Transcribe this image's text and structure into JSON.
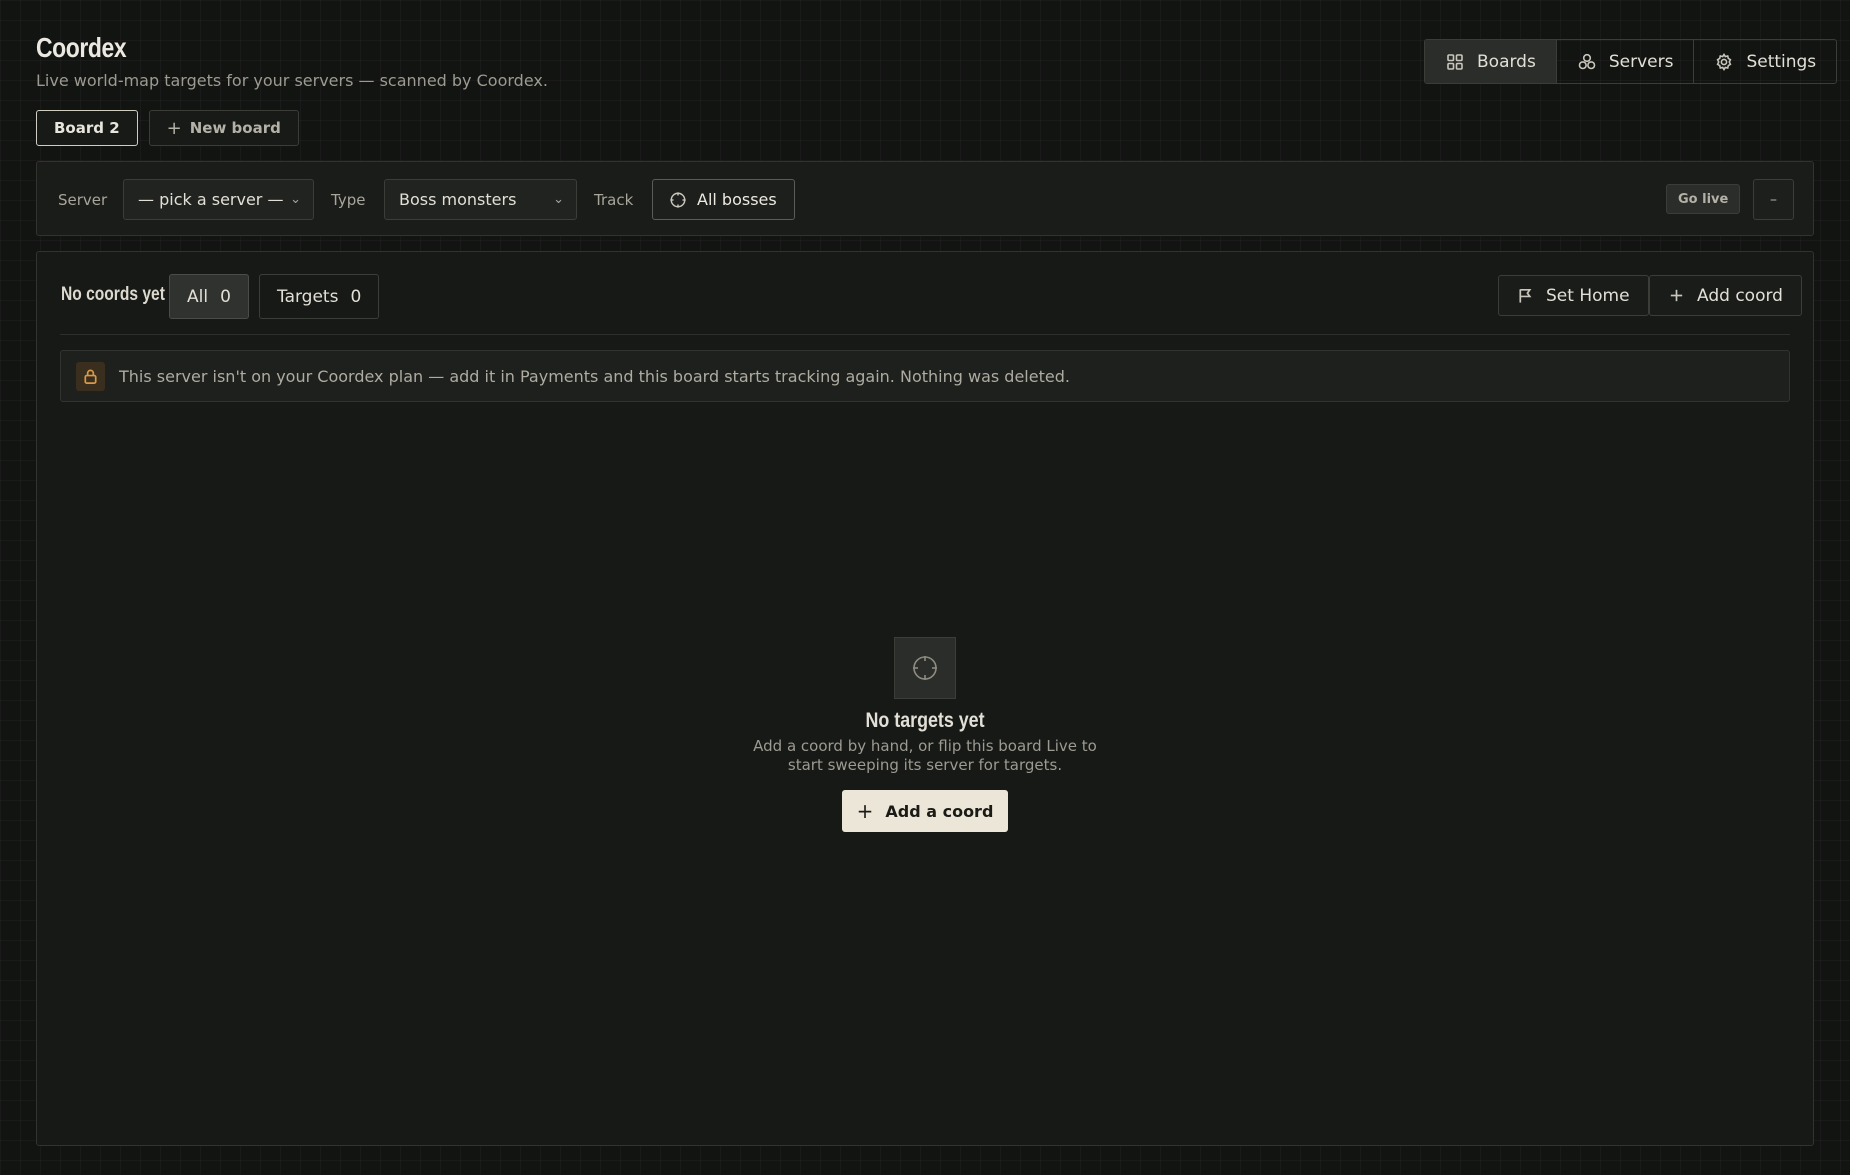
{
  "app": {
    "title": "Coordex",
    "subtitle": "Live world-map targets for your servers — scanned by Coordex."
  },
  "nav": {
    "boards": "Boards",
    "servers": "Servers",
    "settings": "Settings",
    "active": "Boards"
  },
  "board_tabs": {
    "current": "Board 2",
    "new_board": "New board"
  },
  "controls": {
    "server_label": "Server",
    "server_value": "— pick a server —",
    "type_label": "Type",
    "type_value": "Boss monsters",
    "track_label": "Track",
    "track_value": "All bosses",
    "go_live": "Go live",
    "dash": "–"
  },
  "panel": {
    "status": "No coords yet",
    "filter_all_label": "All",
    "filter_all_count": "0",
    "filter_targets_label": "Targets",
    "filter_targets_count": "0",
    "set_home": "Set Home",
    "add_coord": "Add coord",
    "notice": "This server isn't on your Coordex plan — add it in Payments and this board starts tracking again. Nothing was deleted."
  },
  "empty_state": {
    "title": "No targets yet",
    "description": "Add a coord by hand, or flip this board Live to start sweeping its server for targets.",
    "button": "Add a coord"
  },
  "colors": {
    "background": "#121412",
    "panel": "#171916",
    "primary_button": "#ebe6d8",
    "warning_icon": "#d99a48"
  }
}
